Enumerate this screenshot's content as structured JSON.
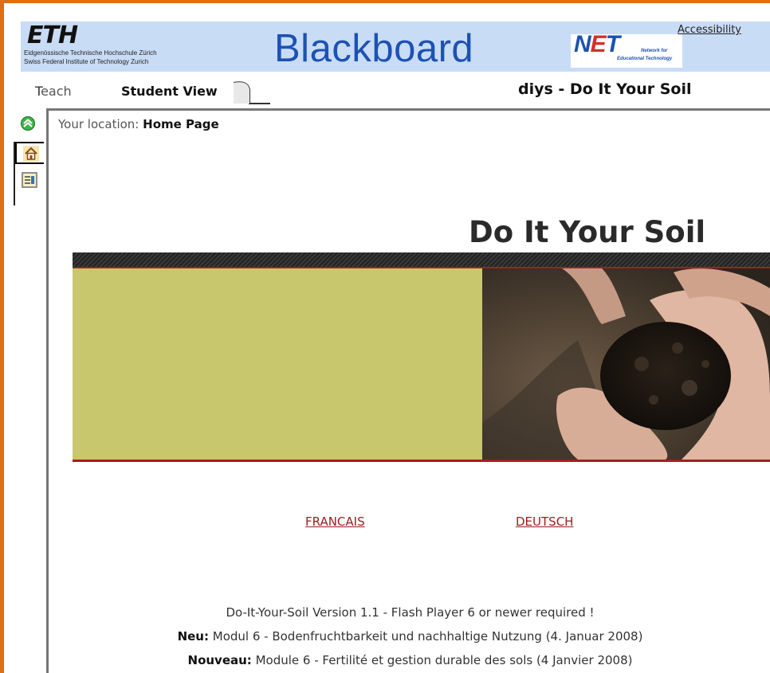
{
  "banner": {
    "eth_logo_text": "ETH",
    "eth_line1": "Eidgenössische Technische Hochschule Zürich",
    "eth_line2": "Swiss Federal Institute of Technology Zurich",
    "product_name": "Blackboard",
    "net_logo_n": "N",
    "net_logo_e": "E",
    "net_logo_t": "T",
    "net_sub1": "Network for",
    "net_sub2": "Educational Technology",
    "accessibility_link": "Accessibility"
  },
  "tabs": {
    "teach_first": "T",
    "teach_rest": "each",
    "student_view": "Student View"
  },
  "course_title": "diys - Do It Your Soil",
  "location": {
    "label": "Your location:",
    "value": "Home Page"
  },
  "hero": {
    "title": "Do It Your Soil"
  },
  "language_links": {
    "french": "FRANCAIS",
    "german": "DEUTSCH"
  },
  "footer": {
    "line1": "Do-It-Your-Soil Version 1.1 - Flash Player 6 or newer required !",
    "line2_bold": "Neu:",
    "line2_text": "Modul 6 - Bodenfruchtbarkeit und nachhaltige Nutzung (4. Januar 2008)",
    "line3_bold": "Nouveau:",
    "line3_text": "Module 6 - Fertilité et gestion durable des sols (4 Janvier 2008)"
  },
  "colors": {
    "frame": "#e06e12",
    "banner_bg": "#c9dcf6",
    "brand_blue": "#1d52b3",
    "olive": "#c8c76d",
    "link_red": "#9c1b1b"
  },
  "icons": [
    "collapse-up-icon",
    "home-icon",
    "tools-icon"
  ]
}
